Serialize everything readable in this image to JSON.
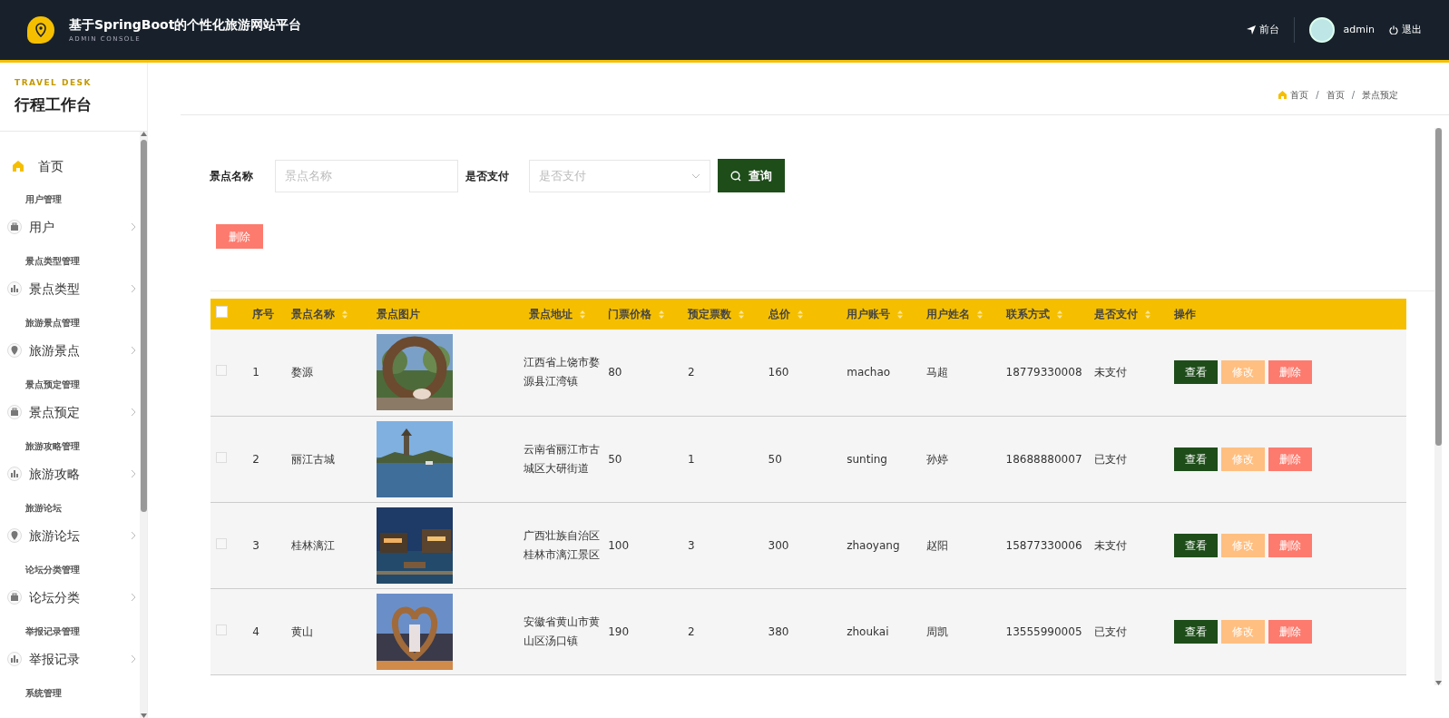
{
  "header": {
    "title": "基于SpringBoot的个性化旅游网站平台",
    "subtitle": "ADMIN CONSOLE",
    "front_link": "前台",
    "user": "admin",
    "logout": "退出"
  },
  "sidebar": {
    "eyebrow": "TRAVEL DESK",
    "title": "行程工作台",
    "home": "首页",
    "groups": [
      {
        "heading": "用户管理",
        "item": "用户"
      },
      {
        "heading": "景点类型管理",
        "item": "景点类型"
      },
      {
        "heading": "旅游景点管理",
        "item": "旅游景点"
      },
      {
        "heading": "景点预定管理",
        "item": "景点预定"
      },
      {
        "heading": "旅游攻略管理",
        "item": "旅游攻略"
      },
      {
        "heading": "旅游论坛",
        "item": "旅游论坛"
      },
      {
        "heading": "论坛分类管理",
        "item": "论坛分类"
      },
      {
        "heading": "举报记录管理",
        "item": "举报记录"
      },
      {
        "heading": "系统管理"
      }
    ]
  },
  "breadcrumb": {
    "items": [
      "首页",
      "首页",
      "景点预定"
    ],
    "separators": [
      "/",
      "/"
    ]
  },
  "search": {
    "fields": [
      {
        "label": "景点名称",
        "placeholder": "景点名称",
        "kind": "text"
      },
      {
        "label": "是否支付",
        "placeholder": "是否支付",
        "kind": "select"
      }
    ],
    "button": "查询"
  },
  "bulk_delete": "删除",
  "table": {
    "select_all": {
      "checked": false
    },
    "columns": [
      {
        "label": "序号",
        "sortable": false
      },
      {
        "label": "景点名称",
        "sortable": true
      },
      {
        "label": "景点图片",
        "sortable": false
      },
      {
        "label": "景点地址",
        "sortable": true
      },
      {
        "label": "门票价格",
        "sortable": true
      },
      {
        "label": "预定票数",
        "sortable": true
      },
      {
        "label": "总价",
        "sortable": true
      },
      {
        "label": "用户账号",
        "sortable": true
      },
      {
        "label": "用户姓名",
        "sortable": true
      },
      {
        "label": "联系方式",
        "sortable": true
      },
      {
        "label": "是否支付",
        "sortable": true
      },
      {
        "label": "操作",
        "sortable": false
      }
    ],
    "rows": [
      {
        "checked": false,
        "cells": [
          "1",
          "婺源",
          "",
          "江西省上饶市婺源县江湾镇",
          "80",
          "2",
          "160",
          "machao",
          "马超",
          "18779330008",
          "未支付"
        ],
        "actions": [
          "查看",
          "修改",
          "删除"
        ]
      },
      {
        "checked": false,
        "cells": [
          "2",
          "丽江古城",
          "",
          "云南省丽江市古城区大研街道",
          "50",
          "1",
          "50",
          "sunting",
          "孙婷",
          "18688880007",
          "已支付"
        ],
        "actions": [
          "查看",
          "修改",
          "删除"
        ]
      },
      {
        "checked": false,
        "cells": [
          "3",
          "桂林漓江",
          "",
          "广西壮族自治区桂林市漓江景区",
          "100",
          "3",
          "300",
          "zhaoyang",
          "赵阳",
          "15877330006",
          "未支付"
        ],
        "actions": [
          "查看",
          "修改",
          "删除"
        ]
      },
      {
        "checked": false,
        "cells": [
          "4",
          "黄山",
          "",
          "安徽省黄山市黄山区汤口镇",
          "190",
          "2",
          "380",
          "zhoukai",
          "周凯",
          "13555990005",
          "已支付"
        ],
        "actions": [
          "查看",
          "修改",
          "删除"
        ]
      }
    ]
  }
}
